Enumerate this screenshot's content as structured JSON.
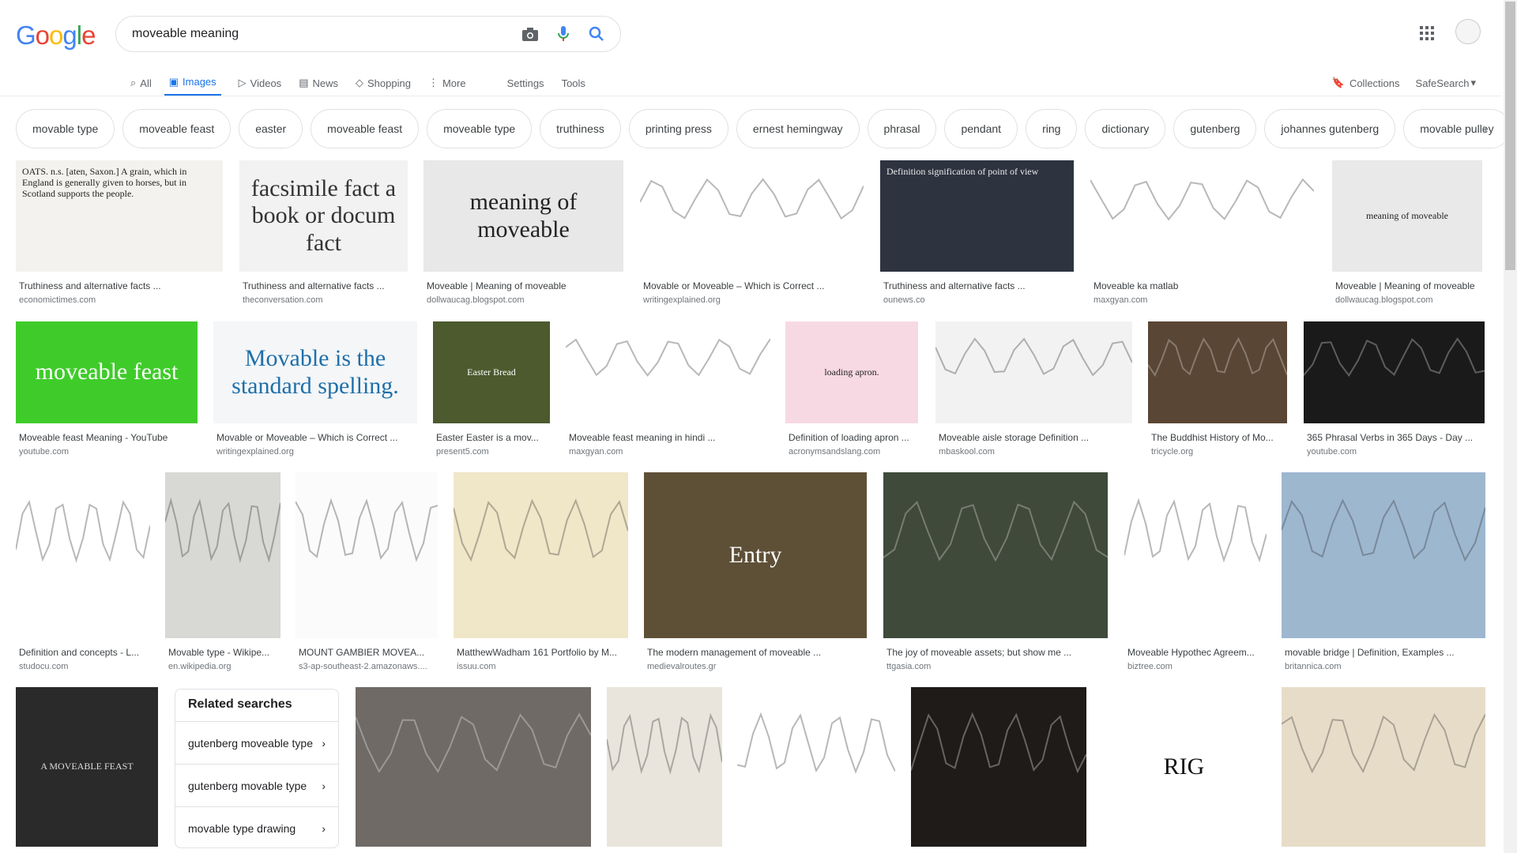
{
  "logo": {
    "letters": [
      "G",
      "o",
      "o",
      "g",
      "l",
      "e"
    ],
    "colors": [
      "#4285f4",
      "#ea4335",
      "#fbbc05",
      "#4285f4",
      "#34a853",
      "#ea4335"
    ]
  },
  "search": {
    "query": "moveable meaning"
  },
  "tabs": [
    {
      "label": "All",
      "icon": "search-icon"
    },
    {
      "label": "Images",
      "icon": "image-icon"
    },
    {
      "label": "Videos",
      "icon": "video-icon"
    },
    {
      "label": "News",
      "icon": "news-icon"
    },
    {
      "label": "Shopping",
      "icon": "tag-icon"
    },
    {
      "label": "More",
      "icon": "more-vert-icon"
    },
    {
      "label": "Settings"
    },
    {
      "label": "Tools"
    }
  ],
  "right_tabs": {
    "collections": "Collections",
    "safesearch": "SafeSearch"
  },
  "chips": [
    "movable type",
    "moveable feast",
    "easter",
    "moveable feast",
    "moveable type",
    "truthiness",
    "printing press",
    "ernest hemingway",
    "phrasal",
    "pendant",
    "ring",
    "dictionary",
    "gutenberg",
    "johannes gutenberg",
    "movable pulley"
  ],
  "results": [
    {
      "title": "Truthiness and alternative facts ...",
      "source": "economictimes.com",
      "text": "OATS. n.s. [aten, Saxon.] A grain, which in England is generally given to horses, but in Scotland supports the people.",
      "bg": "#f4f2ee",
      "fg": "#222"
    },
    {
      "title": "Truthiness and alternative facts ...",
      "source": "theconversation.com",
      "text": "facsimile fact a book or docum fact",
      "bg": "#f2f2f2",
      "fg": "#333"
    },
    {
      "title": "Moveable | Meaning of moveable",
      "source": "dollwaucag.blogspot.com",
      "text": "meaning of moveable",
      "bg": "#e8e8e8",
      "fg": "#222"
    },
    {
      "title": "Movable or Moveable – Which is Correct ...",
      "source": "writingexplained.org",
      "text": "",
      "bg": "#ffffff",
      "fg": "#333"
    },
    {
      "title": "Truthiness and alternative facts ...",
      "source": "ounews.co",
      "text": "Definition signification of point of view",
      "bg": "#2d3440",
      "fg": "#eaeaea"
    },
    {
      "title": "Moveable ka matlab",
      "source": "maxgyan.com",
      "text": "",
      "bg": "#ffffff",
      "fg": "#333"
    },
    {
      "title": "Moveable | Meaning of moveable",
      "source": "dollwaucag.blogspot.com",
      "text": "meaning of moveable",
      "bg": "#e9e9e9",
      "fg": "#222"
    },
    {
      "title": "Moveable feast Meaning - YouTube",
      "source": "youtube.com",
      "text": "moveable feast",
      "bg": "#3fcc2a",
      "fg": "#ffffff"
    },
    {
      "title": "Movable or Moveable – Which is Correct ...",
      "source": "writingexplained.org",
      "text": "Movable is the standard spelling.",
      "bg": "#f4f6f8",
      "fg": "#1f6fa8"
    },
    {
      "title": "Easter Easter is a mov...",
      "source": "present5.com",
      "text": "Easter Bread",
      "bg": "#4c5a2e",
      "fg": "#ffffff"
    },
    {
      "title": "Moveable feast meaning in hindi ...",
      "source": "maxgyan.com",
      "text": "",
      "bg": "#ffffff",
      "fg": "#333"
    },
    {
      "title": "Definition of loading apron ...",
      "source": "acronymsandslang.com",
      "text": "loading apron.",
      "bg": "#f7d9e4",
      "fg": "#222"
    },
    {
      "title": "Moveable aisle storage Definition ...",
      "source": "mbaskool.com",
      "text": "",
      "bg": "#f2f2f2",
      "fg": "#333"
    },
    {
      "title": "The Buddhist History of Mo...",
      "source": "tricycle.org",
      "text": "",
      "bg": "#5a4634",
      "fg": "#ddd"
    },
    {
      "title": "365 Phrasal Verbs in 365 Days - Day ...",
      "source": "youtube.com",
      "text": "",
      "bg": "#1a1a1a",
      "fg": "#ddd"
    },
    {
      "title": "Definition and concepts - L...",
      "source": "studocu.com",
      "text": "",
      "bg": "#ffffff",
      "fg": "#333"
    },
    {
      "title": "Movable type - Wikipe...",
      "source": "en.wikipedia.org",
      "text": "",
      "bg": "#d8d8d4",
      "fg": "#333"
    },
    {
      "title": "MOUNT GAMBIER MOVEA...",
      "source": "s3-ap-southeast-2.amazonaws....",
      "text": "",
      "bg": "#fbfbfb",
      "fg": "#333"
    },
    {
      "title": "MatthewWadham 161 Portfolio by M...",
      "source": "issuu.com",
      "text": "",
      "bg": "#f0e6c8",
      "fg": "#333"
    },
    {
      "title": "The modern management of moveable ...",
      "source": "medievalroutes.gr",
      "text": "Entry",
      "bg": "#5e5037",
      "fg": "#ffffff"
    },
    {
      "title": "The joy of moveable assets; but show me ...",
      "source": "ttgasia.com",
      "text": "",
      "bg": "#3f4a3a",
      "fg": "#ddd"
    },
    {
      "title": "Moveable Hypothec Agreem...",
      "source": "biztree.com",
      "text": "",
      "bg": "#ffffff",
      "fg": "#333"
    },
    {
      "title": "movable bridge | Definition, Examples ...",
      "source": "britannica.com",
      "text": "",
      "bg": "#9db7cf",
      "fg": "#333"
    },
    {
      "title": "",
      "source": "",
      "text": "A MOVEABLE FEAST",
      "bg": "#2a2a2a",
      "fg": "#ddd"
    },
    {
      "title": "",
      "source": "",
      "text": "",
      "bg": "#6f6a66",
      "fg": "#eee"
    },
    {
      "title": "",
      "source": "",
      "text": "",
      "bg": "#e9e5dc",
      "fg": "#333"
    },
    {
      "title": "",
      "source": "",
      "text": "",
      "bg": "#ffffff",
      "fg": "#333"
    },
    {
      "title": "",
      "source": "",
      "text": "",
      "bg": "#1e1b18",
      "fg": "#eee"
    },
    {
      "title": "",
      "source": "",
      "text": "RIG",
      "bg": "#ffffff",
      "fg": "#111"
    },
    {
      "title": "",
      "source": "",
      "text": "",
      "bg": "#e7dcc8",
      "fg": "#333"
    }
  ],
  "related": {
    "heading": "Related searches",
    "items": [
      "gutenberg moveable type",
      "gutenberg movable type",
      "movable type drawing"
    ]
  }
}
